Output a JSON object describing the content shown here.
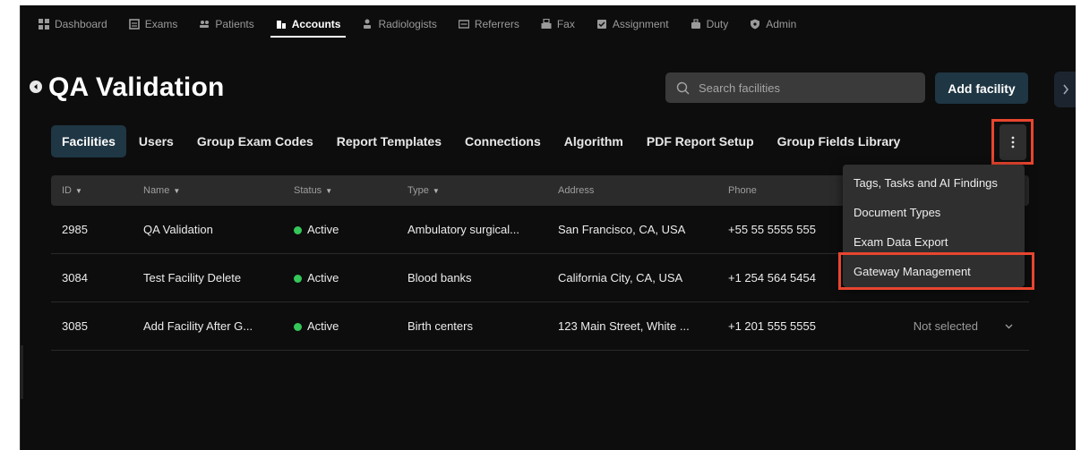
{
  "nav": {
    "items": [
      {
        "label": "Dashboard",
        "icon": "dashboard-icon",
        "active": false
      },
      {
        "label": "Exams",
        "icon": "exams-icon",
        "active": false
      },
      {
        "label": "Patients",
        "icon": "patients-icon",
        "active": false
      },
      {
        "label": "Accounts",
        "icon": "accounts-icon",
        "active": true
      },
      {
        "label": "Radiologists",
        "icon": "radiologists-icon",
        "active": false
      },
      {
        "label": "Referrers",
        "icon": "referrers-icon",
        "active": false
      },
      {
        "label": "Fax",
        "icon": "fax-icon",
        "active": false
      },
      {
        "label": "Assignment",
        "icon": "assignment-icon",
        "active": false
      },
      {
        "label": "Duty",
        "icon": "duty-icon",
        "active": false
      },
      {
        "label": "Admin",
        "icon": "admin-icon",
        "active": false
      }
    ]
  },
  "header": {
    "title": "QA Validation",
    "search_placeholder": "Search facilities",
    "add_label": "Add facility"
  },
  "tabs": [
    {
      "label": "Facilities",
      "active": true
    },
    {
      "label": "Users",
      "active": false
    },
    {
      "label": "Group Exam Codes",
      "active": false
    },
    {
      "label": "Report Templates",
      "active": false
    },
    {
      "label": "Connections",
      "active": false
    },
    {
      "label": "Algorithm",
      "active": false
    },
    {
      "label": "PDF Report Setup",
      "active": false
    },
    {
      "label": "Group Fields Library",
      "active": false
    }
  ],
  "table": {
    "columns": [
      "ID",
      "Name",
      "Status",
      "Type",
      "Address",
      "Phone"
    ],
    "rows": [
      {
        "id": "2985",
        "name": "QA Validation",
        "status": "Active",
        "type": "Ambulatory surgical...",
        "address": "San Francisco, CA, USA",
        "phone": "+55 55 5555 555",
        "extra": ""
      },
      {
        "id": "3084",
        "name": "Test Facility Delete",
        "status": "Active",
        "type": "Blood banks",
        "address": "California City, CA, USA",
        "phone": "+1 254 564 5454",
        "extra": ""
      },
      {
        "id": "3085",
        "name": "Add Facility After G...",
        "status": "Active",
        "type": "Birth centers",
        "address": "123 Main Street, White ...",
        "phone": "+1 201 555 5555",
        "extra": "Not selected"
      }
    ]
  },
  "menu": {
    "items": [
      "Tags, Tasks and AI Findings",
      "Document Types",
      "Exam Data Export",
      "Gateway Management"
    ]
  },
  "colors": {
    "background": "#0d0d0d",
    "active_tab": "#1f3644",
    "status_active": "#34c759",
    "highlight": "#e8452f"
  }
}
